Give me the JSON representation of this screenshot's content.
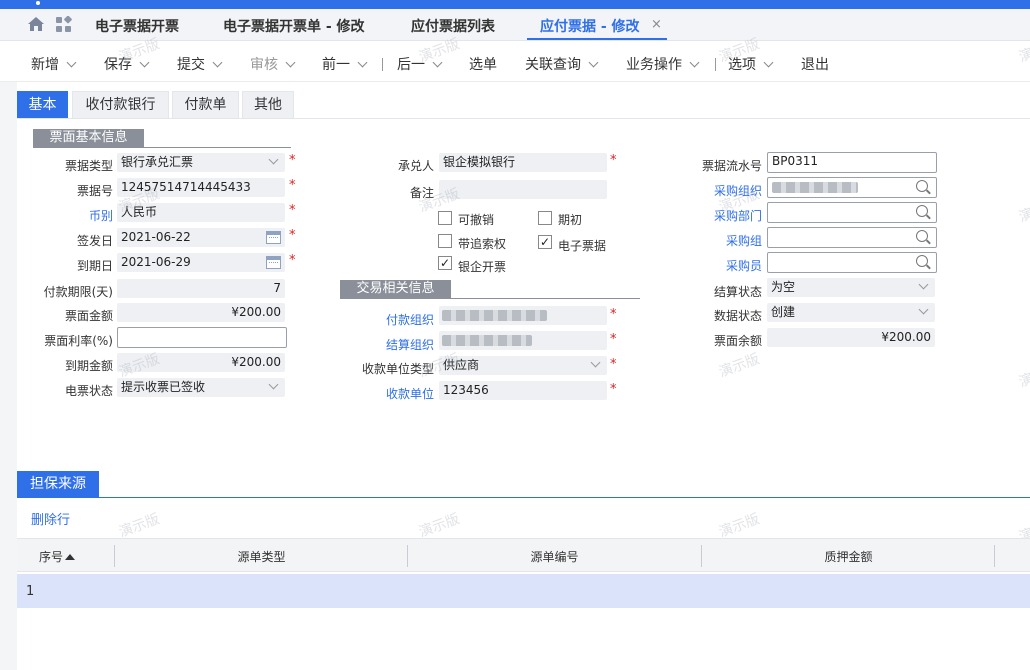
{
  "tabs": [
    {
      "label": "电子票据开票"
    },
    {
      "label": "电子票据开票单 - 修改"
    },
    {
      "label": "应付票据列表"
    },
    {
      "label": "应付票据 - 修改"
    }
  ],
  "tab_close": "×",
  "toolbar": {
    "new": "新增",
    "save": "保存",
    "submit": "提交",
    "audit": "审核",
    "prev": "前一",
    "next": "后一",
    "select": "选单",
    "related": "关联查询",
    "business": "业务操作",
    "options": "选项",
    "exit": "退出"
  },
  "subtabs": [
    "基本",
    "收付款银行",
    "付款单",
    "其他"
  ],
  "sections": {
    "basic": "票面基本信息",
    "trade": "交易相关信息"
  },
  "form": {
    "bill_type": {
      "label": "票据类型",
      "value": "银行承兑汇票"
    },
    "bill_no": {
      "label": "票据号",
      "value": "12457514714445433"
    },
    "currency": {
      "label": "币别",
      "value": "人民币"
    },
    "issue_date": {
      "label": "签发日",
      "value": "2021-06-22"
    },
    "due_date": {
      "label": "到期日",
      "value": "2021-06-29"
    },
    "pay_term": {
      "label": "付款期限(天)",
      "value": "7"
    },
    "face_amount": {
      "label": "票面金额",
      "value": "¥200.00"
    },
    "face_rate": {
      "label": "票面利率(%)",
      "value": ""
    },
    "due_amount": {
      "label": "到期金额",
      "value": "¥200.00"
    },
    "e_status": {
      "label": "电票状态",
      "value": "提示收票已签收"
    },
    "acceptor": {
      "label": "承兑人",
      "value": "银企模拟银行"
    },
    "remark": {
      "label": "备注",
      "value": ""
    },
    "checks": {
      "revocable": "可撤销",
      "initial": "期初",
      "recourse": "带追索权",
      "e_bill": "电子票据",
      "bank_issue": "银企开票"
    },
    "check_mark": "✓",
    "pay_org": {
      "label": "付款组织"
    },
    "settle_org": {
      "label": "结算组织"
    },
    "payee_type": {
      "label": "收款单位类型",
      "value": "供应商"
    },
    "payee": {
      "label": "收款单位",
      "value": "123456"
    },
    "serial_no": {
      "label": "票据流水号",
      "value": "BP0311"
    },
    "purchase_org": {
      "label": "采购组织"
    },
    "purchase_dept": {
      "label": "采购部门"
    },
    "purchase_group": {
      "label": "采购组"
    },
    "buyer": {
      "label": "采购员"
    },
    "settle_status": {
      "label": "结算状态",
      "value": "为空"
    },
    "data_status": {
      "label": "数据状态",
      "value": "创建"
    },
    "face_balance": {
      "label": "票面余额",
      "value": "¥200.00"
    }
  },
  "watermark": "演示版",
  "detail": {
    "tab": "担保来源",
    "delete_row": "删除行",
    "columns": [
      "序号",
      "源单类型",
      "源单编号",
      "质押金额"
    ],
    "rows": [
      {
        "seq": "1"
      }
    ]
  }
}
